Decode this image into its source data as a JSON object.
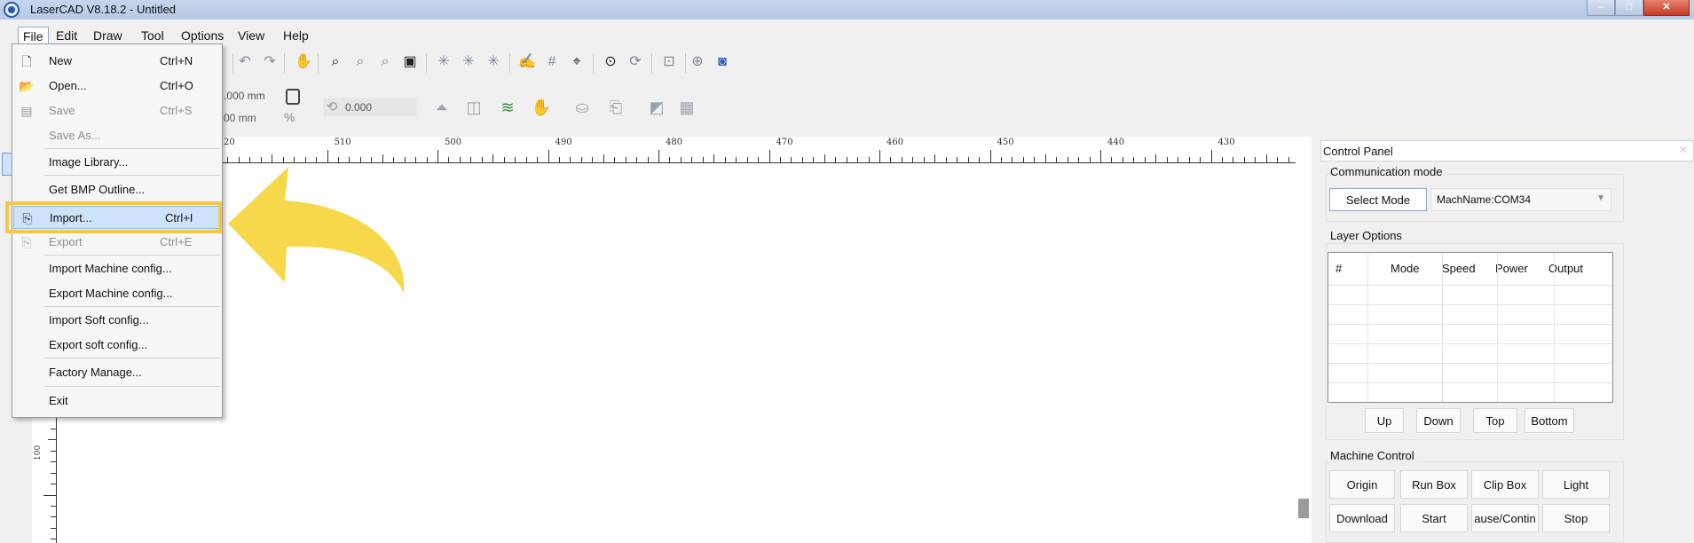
{
  "window": {
    "title": "LaserCAD V8.18.2 - Untitled"
  },
  "menubar": [
    {
      "label": "File",
      "name": "menu-file"
    },
    {
      "label": "Edit",
      "name": "menu-edit"
    },
    {
      "label": "Draw",
      "name": "menu-draw"
    },
    {
      "label": "Tool",
      "name": "menu-tool"
    },
    {
      "label": "Options",
      "name": "menu-options"
    },
    {
      "label": "View",
      "name": "menu-view"
    },
    {
      "label": "Help",
      "name": "menu-help"
    }
  ],
  "file_menu": {
    "new": {
      "label": "New",
      "shortcut": "Ctrl+N"
    },
    "open": {
      "label": "Open...",
      "shortcut": "Ctrl+O"
    },
    "save": {
      "label": "Save",
      "shortcut": "Ctrl+S"
    },
    "save_as": {
      "label": "Save As..."
    },
    "image_library": {
      "label": "Image Library..."
    },
    "get_bmp_outline": {
      "label": "Get BMP Outline..."
    },
    "import": {
      "label": "Import...",
      "shortcut": "Ctrl+I"
    },
    "export": {
      "label": "Export",
      "shortcut": "Ctrl+E"
    },
    "import_machine": {
      "label": "Import Machine config..."
    },
    "export_machine": {
      "label": "Export Machine config..."
    },
    "import_soft": {
      "label": "Import Soft config..."
    },
    "export_soft": {
      "label": "Export soft config..."
    },
    "factory_manage": {
      "label": "Factory Manage..."
    },
    "exit": {
      "label": "Exit"
    }
  },
  "toolbar2": {
    "width_value": ".000 mm",
    "height_value": "00 mm",
    "percent_label": "%",
    "rotate_value": "0.000"
  },
  "ruler": {
    "x_labels": [
      "20",
      "510",
      "500",
      "490",
      "480",
      "470",
      "460",
      "450",
      "440",
      "430"
    ],
    "y_labels": [
      "100"
    ]
  },
  "control_panel": {
    "title": "Control Panel",
    "communication_mode": {
      "title": "Communication mode",
      "select_mode": "Select Mode",
      "machine_name": "MachName:COM34"
    },
    "layer_options": {
      "title": "Layer Options",
      "columns": [
        "#",
        "Mode",
        "Speed",
        "Power",
        "Output"
      ],
      "up": "Up",
      "down": "Down",
      "top": "Top",
      "bottom": "Bottom"
    },
    "machine_control": {
      "title": "Machine Control",
      "origin": "Origin",
      "run_box": "Run Box",
      "clip_box": "Clip Box",
      "light": "Light",
      "download": "Download",
      "start": "Start",
      "pause_continue": "ause/Contin",
      "stop": "Stop"
    }
  },
  "colors": {
    "highlight": "#cde3fa",
    "callout_yellow": "#f2c84b",
    "titlebar": "#b7c9e6"
  }
}
